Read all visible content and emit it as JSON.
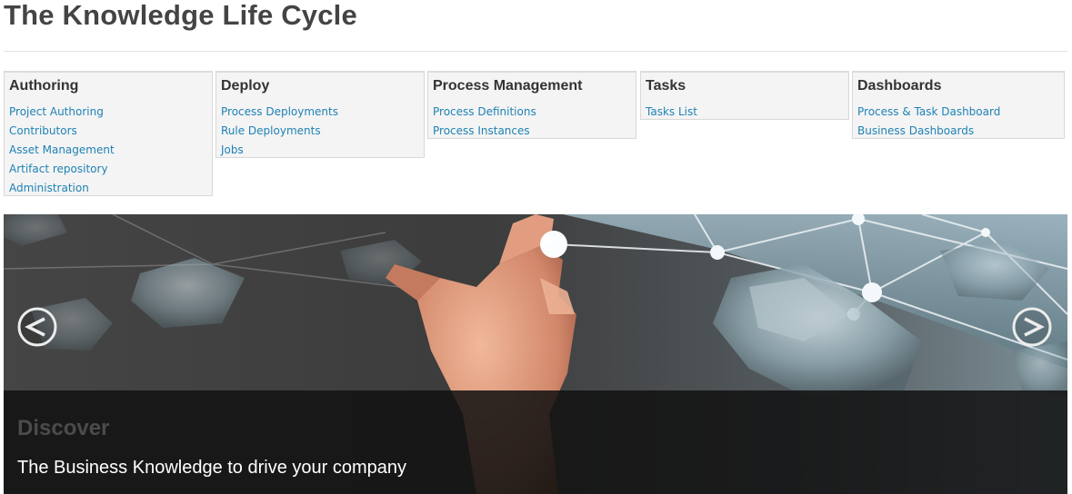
{
  "page": {
    "title": "The Knowledge Life Cycle"
  },
  "panels": [
    {
      "heading": "Authoring",
      "links": [
        "Project Authoring",
        "Contributors",
        "Asset Management",
        "Artifact repository",
        "Administration"
      ]
    },
    {
      "heading": "Deploy",
      "links": [
        "Process Deployments",
        "Rule Deployments",
        "Jobs"
      ]
    },
    {
      "heading": "Process Management",
      "links": [
        "Process Definitions",
        "Process Instances"
      ]
    },
    {
      "heading": "Tasks",
      "links": [
        "Tasks List"
      ]
    },
    {
      "heading": "Dashboards",
      "links": [
        "Process & Task Dashboard",
        "Business Dashboards"
      ]
    }
  ],
  "carousel": {
    "caption_title": "Discover",
    "caption_text": "The Business Knowledge to drive your company",
    "prev_icon": "circle-chevron-left-icon",
    "next_icon": "circle-chevron-right-icon"
  },
  "colors": {
    "link": "#1f82b5",
    "panel_bg": "#f4f4f4",
    "title": "#444444"
  }
}
